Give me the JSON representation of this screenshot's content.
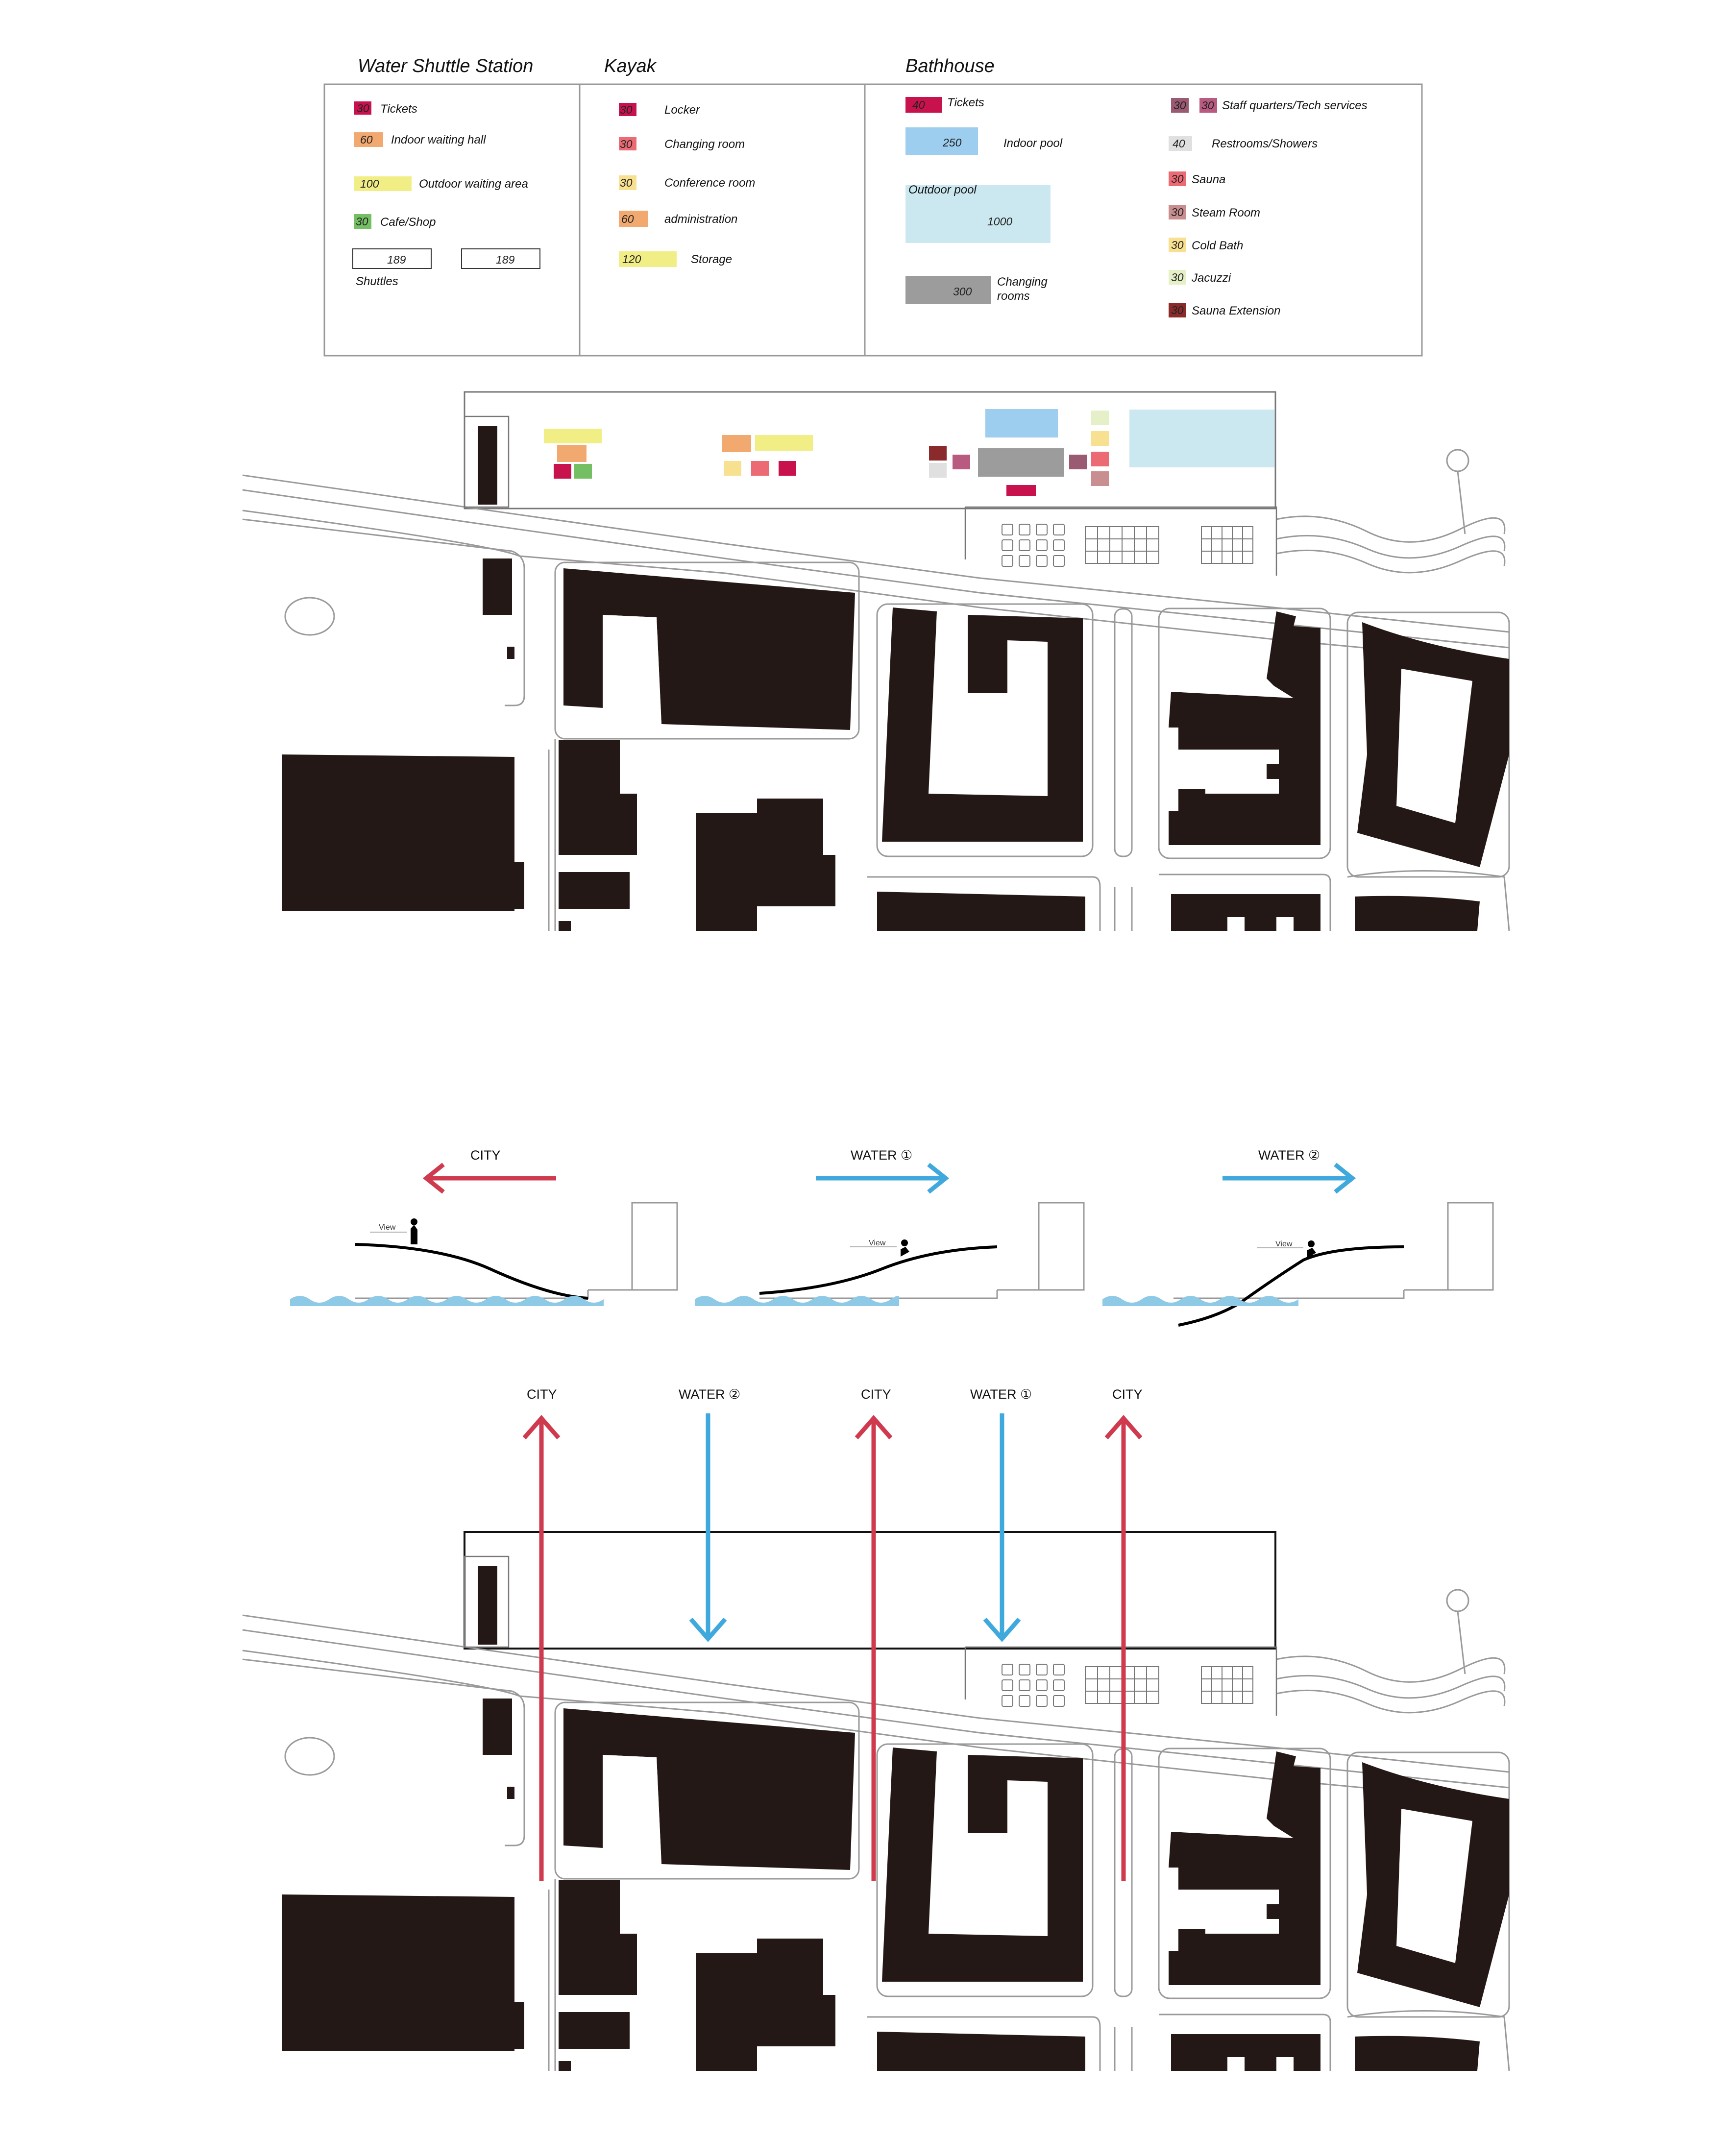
{
  "legend": {
    "water_shuttle": {
      "title": "Water Shuttle Station",
      "items": [
        {
          "value": "30",
          "label": "Tickets",
          "color": "#c8124e"
        },
        {
          "value": "60",
          "label": "Indoor waiting hall",
          "color": "#f2a970"
        },
        {
          "value": "100",
          "label": "Outdoor waiting area",
          "color": "#f2ee86"
        },
        {
          "value": "30",
          "label": "Cafe/Shop",
          "color": "#74bf63"
        }
      ],
      "shuttles": {
        "label": "Shuttles",
        "values": [
          "189",
          "189"
        ]
      }
    },
    "kayak": {
      "title": "Kayak",
      "items": [
        {
          "value": "30",
          "label": "Locker",
          "color": "#c8124e"
        },
        {
          "value": "30",
          "label": "Changing room",
          "color": "#ec6a73"
        },
        {
          "value": "30",
          "label": "Conference room",
          "color": "#f7e08f"
        },
        {
          "value": "60",
          "label": "administration",
          "color": "#f2a970"
        },
        {
          "value": "120",
          "label": "Storage",
          "color": "#f2ee86"
        }
      ]
    },
    "bathhouse": {
      "title": "Bathhouse",
      "items": [
        {
          "value": "40",
          "label": "Tickets",
          "color": "#c8124e"
        },
        {
          "value": "250",
          "label": "Indoor pool",
          "color": "#9dcdef"
        },
        {
          "value": "1000",
          "label": "Outdoor pool",
          "color": "#cbe8f0"
        },
        {
          "value": "300",
          "label": "Changing",
          "label2": "rooms",
          "color": "#9c9c9c"
        }
      ],
      "items_right": [
        {
          "value": "30",
          "value2": "30",
          "label": "Staff quarters/Tech services",
          "color": "#9a5a72",
          "color2": "#b95a80"
        },
        {
          "value": "40",
          "label": "Restrooms/Showers",
          "color": "#e0e0e0"
        },
        {
          "value": "30",
          "label": "Sauna",
          "color": "#ec6a73"
        },
        {
          "value": "30",
          "label": "Steam Room",
          "color": "#c98f90"
        },
        {
          "value": "30",
          "label": "Cold Bath",
          "color": "#f7e08f"
        },
        {
          "value": "30",
          "label": "Jacuzzi",
          "color": "#e6f0c8"
        },
        {
          "value": "30",
          "label": "Sauna Extension",
          "color": "#8b2a2a"
        }
      ]
    }
  },
  "sections": [
    {
      "label": "CITY",
      "direction": "left",
      "color": "#d03a4e",
      "view": "View"
    },
    {
      "label": "WATER ①",
      "direction": "right",
      "color": "#3fa9dd",
      "view": "View"
    },
    {
      "label": "WATER ②",
      "direction": "right",
      "color": "#3fa9dd",
      "view": "View"
    }
  ],
  "flow_arrows": [
    {
      "label": "CITY",
      "direction": "up",
      "color": "#d03a4e"
    },
    {
      "label": "WATER ②",
      "direction": "down",
      "color": "#3fa9dd"
    },
    {
      "label": "CITY",
      "direction": "up",
      "color": "#d03a4e"
    },
    {
      "label": "WATER ①",
      "direction": "down",
      "color": "#3fa9dd"
    },
    {
      "label": "CITY",
      "direction": "up",
      "color": "#d03a4e"
    }
  ],
  "colors": {
    "building": "#231815",
    "water": "#8ecae6",
    "outline": "#999999"
  }
}
